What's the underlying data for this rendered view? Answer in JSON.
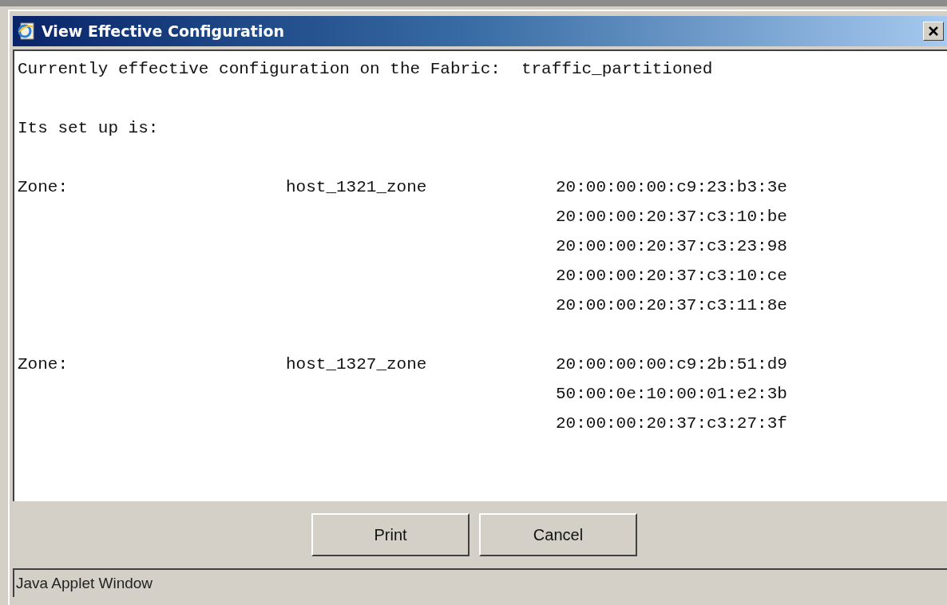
{
  "window": {
    "title": "View Effective Configuration"
  },
  "content": {
    "header_label": "Currently effective configuration on the Fabric:",
    "header_value": "traffic_partitioned",
    "setup_label": "Its set up is:",
    "zones": [
      {
        "label": "Zone:",
        "name": "host_1321_zone",
        "members": [
          "20:00:00:00:c9:23:b3:3e",
          "20:00:00:20:37:c3:10:be",
          "20:00:00:20:37:c3:23:98",
          "20:00:00:20:37:c3:10:ce",
          "20:00:00:20:37:c3:11:8e"
        ]
      },
      {
        "label": "Zone:",
        "name": "host_1327_zone",
        "members": [
          "20:00:00:00:c9:2b:51:d9",
          "50:00:0e:10:00:01:e2:3b",
          "20:00:00:20:37:c3:27:3f"
        ]
      }
    ]
  },
  "buttons": [
    "Print",
    "Cancel"
  ],
  "status_bar": "Java Applet Window"
}
